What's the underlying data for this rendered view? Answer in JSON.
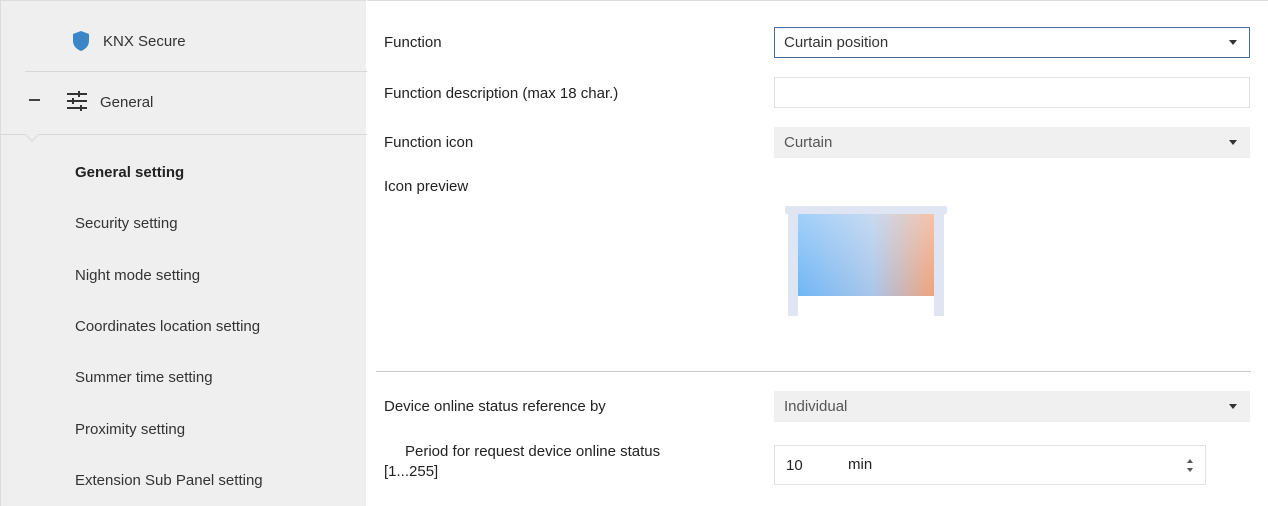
{
  "sidebar": {
    "knx_secure_label": "KNX Secure",
    "general_label": "General",
    "items": [
      {
        "label": "General setting",
        "active": true
      },
      {
        "label": "Security setting",
        "active": false
      },
      {
        "label": "Night mode setting",
        "active": false
      },
      {
        "label": "Coordinates location setting",
        "active": false
      },
      {
        "label": "Summer time setting",
        "active": false
      },
      {
        "label": "Proximity setting",
        "active": false
      },
      {
        "label": "Extension Sub Panel setting",
        "active": false
      }
    ]
  },
  "main": {
    "function": {
      "label": "Function",
      "value": "Curtain position"
    },
    "function_description": {
      "label": "Function description (max 18 char.)",
      "value": ""
    },
    "function_icon": {
      "label": "Function icon",
      "value": "Curtain"
    },
    "icon_preview": {
      "label": "Icon preview",
      "icon": "curtain-icon"
    },
    "device_online_status": {
      "label": "Device online status reference by",
      "value": "Individual"
    },
    "period_request": {
      "label_line1": "Period for request device online status",
      "label_line2": "[1...255]",
      "value": "10",
      "unit": "min"
    }
  },
  "colors": {
    "sidebar_bg": "#efefef",
    "shield_blue": "#3b86c6",
    "focus_border": "#4a6d9a"
  }
}
